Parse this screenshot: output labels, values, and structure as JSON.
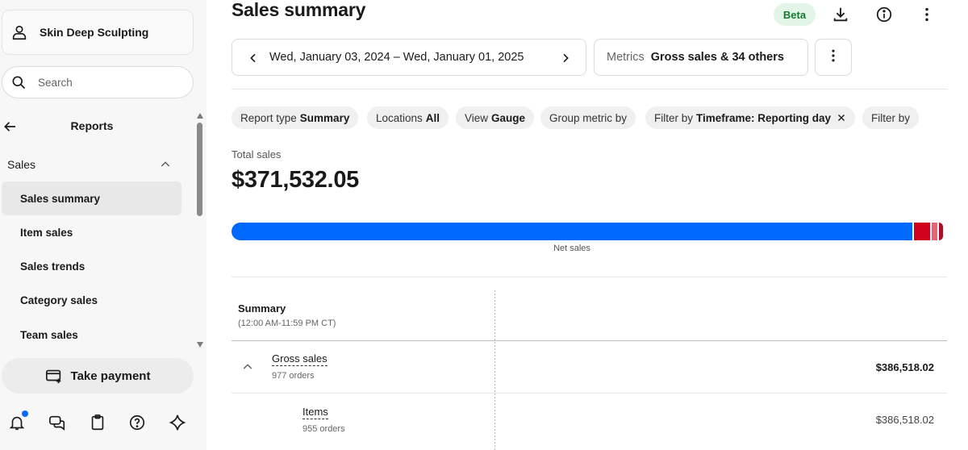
{
  "sidebar": {
    "business_name": "Skin Deep Sculpting",
    "search_placeholder": "Search",
    "nav_title": "Reports",
    "section_label": "Sales",
    "items": [
      {
        "label": "Sales summary",
        "active": true
      },
      {
        "label": "Item sales",
        "active": false
      },
      {
        "label": "Sales trends",
        "active": false
      },
      {
        "label": "Category sales",
        "active": false
      },
      {
        "label": "Team sales",
        "active": false
      }
    ],
    "take_payment_label": "Take payment",
    "footer_icons": [
      "bell-icon",
      "chat-icon",
      "clipboard-icon",
      "help-icon",
      "sparkle-icon"
    ]
  },
  "header": {
    "title": "Sales summary",
    "beta_label": "Beta",
    "icons": [
      "download-icon",
      "info-icon",
      "more-vertical-icon"
    ]
  },
  "toolbar": {
    "date_range": "Wed, January 03, 2024 – Wed, January 01, 2025",
    "metrics_key": "Metrics",
    "metrics_value": "Gross sales & 34 others"
  },
  "filters": [
    {
      "key": "Report type",
      "value": "Summary"
    },
    {
      "key": "Locations",
      "value": "All"
    },
    {
      "key": "View",
      "value": "Gauge"
    },
    {
      "key": "Group metric by",
      "value": ""
    },
    {
      "key": "Filter by",
      "value": "Timeframe: Reporting day",
      "removable": true
    },
    {
      "key": "Filter by",
      "value": ""
    }
  ],
  "totals": {
    "label": "Total sales",
    "value": "$371,532.05"
  },
  "gauge": {
    "label": "Net sales",
    "segments": [
      {
        "name": "net-sales",
        "fraction": 0.952,
        "color": "#006aff"
      },
      {
        "name": "segment-2",
        "fraction": 0.022,
        "color": "#d0021b"
      },
      {
        "name": "segment-3",
        "fraction": 0.008,
        "color": "#e8636f"
      },
      {
        "name": "segment-4",
        "fraction": 0.006,
        "color": "#a80f24"
      }
    ]
  },
  "table": {
    "header_title": "Summary",
    "header_sub": "(12:00 AM-11:59 PM CT)",
    "rows": [
      {
        "name": "Gross sales",
        "sub": "977 orders",
        "amount": "$386,518.02",
        "level": 0
      },
      {
        "name": "Items",
        "sub": "955 orders",
        "amount": "$386,518.02",
        "level": 1
      }
    ]
  },
  "colors": {
    "accent": "#006aff",
    "beta_bg": "#e2f5e6",
    "beta_text": "#137a2c"
  }
}
